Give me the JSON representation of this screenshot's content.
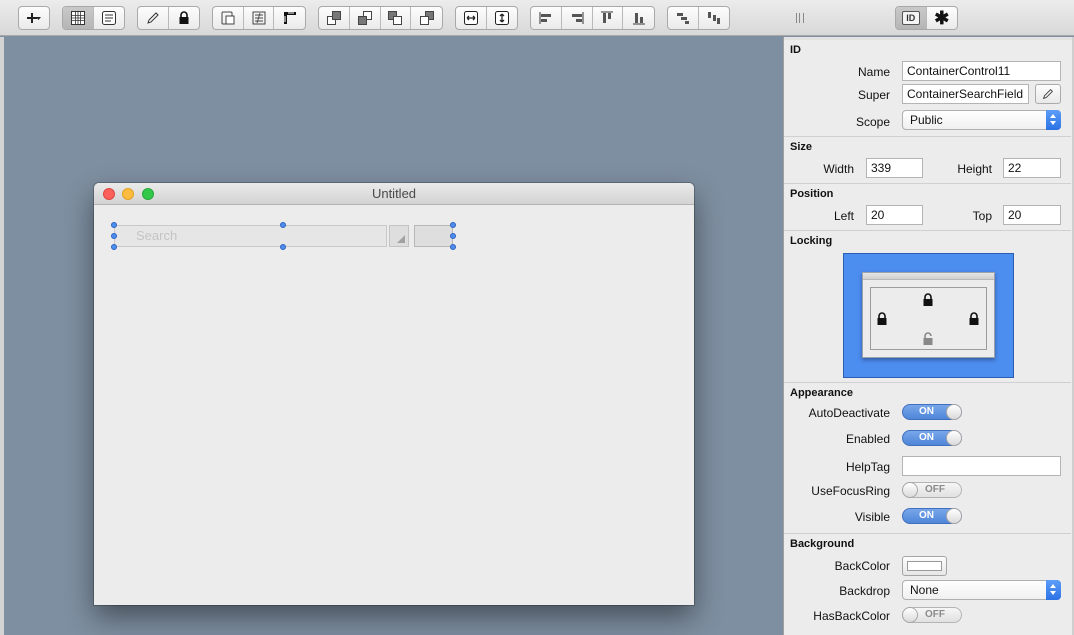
{
  "toolbar": {
    "groups": [
      {
        "name": "add",
        "items": [
          "add-menu"
        ]
      },
      {
        "name": "grid",
        "items": [
          "grid",
          "list"
        ]
      },
      {
        "name": "edit",
        "items": [
          "pencil",
          "lock"
        ]
      },
      {
        "name": "arrange",
        "items": [
          "tab-order",
          "control-order",
          "ruler"
        ]
      },
      {
        "name": "layering",
        "items": [
          "bring-front",
          "bring-forward",
          "send-backward",
          "send-back"
        ]
      },
      {
        "name": "size",
        "items": [
          "equal-width",
          "equal-height"
        ]
      },
      {
        "name": "align",
        "items": [
          "align-left",
          "align-right",
          "align-top",
          "align-bottom"
        ]
      },
      {
        "name": "distribute",
        "items": [
          "distribute-horizontal",
          "distribute-vertical"
        ]
      }
    ],
    "inspector_tabs": [
      "id-tab",
      "gear-tab"
    ],
    "id_tab_label": "ID",
    "gear_symbol": "✱"
  },
  "window": {
    "title": "Untitled",
    "search_placeholder": "Search"
  },
  "inspector": {
    "id": {
      "heading": "ID",
      "name_label": "Name",
      "name_value": "ContainerControl11",
      "super_label": "Super",
      "super_value": "ContainerSearchField",
      "scope_label": "Scope",
      "scope_value": "Public"
    },
    "size": {
      "heading": "Size",
      "width_label": "Width",
      "width_value": "339",
      "height_label": "Height",
      "height_value": "22"
    },
    "position": {
      "heading": "Position",
      "left_label": "Left",
      "left_value": "20",
      "top_label": "Top",
      "top_value": "20"
    },
    "locking": {
      "heading": "Locking",
      "left_locked": true,
      "top_locked": true,
      "right_locked": true,
      "bottom_locked": false
    },
    "appearance": {
      "heading": "Appearance",
      "autodeactivate_label": "AutoDeactivate",
      "autodeactivate_value": "ON",
      "enabled_label": "Enabled",
      "enabled_value": "ON",
      "helptag_label": "HelpTag",
      "helptag_value": "",
      "usefocusring_label": "UseFocusRing",
      "usefocusring_value": "OFF",
      "visible_label": "Visible",
      "visible_value": "ON"
    },
    "background": {
      "heading": "Background",
      "backcolor_label": "BackColor",
      "backcolor_value": "#ffffff",
      "backdrop_label": "Backdrop",
      "backdrop_value": "None",
      "hasbackcolor_label": "HasBackColor",
      "hasbackcolor_value": "OFF"
    }
  },
  "colors": {
    "canvas": "#7e8fa1",
    "accent": "#4c8df0",
    "toggle_on": "#5b8fdc"
  }
}
